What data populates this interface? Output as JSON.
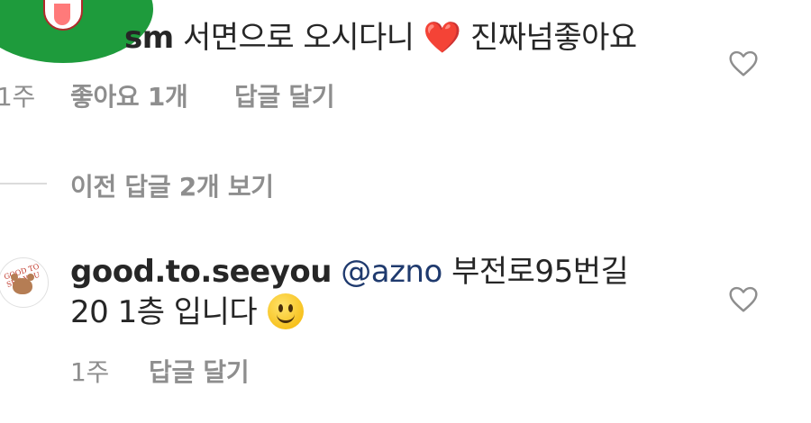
{
  "comment1": {
    "username_partial": "sm",
    "text": "서면으로 오시다니",
    "emoji": "❤️",
    "text_after": "진짜넘좋아요",
    "time": "1주",
    "likes": "좋아요 1개",
    "reply": "답글 달기"
  },
  "view_replies": "이전 답글 2개 보기",
  "comment2": {
    "username": "good.to.seeyou",
    "mention": "@azno",
    "text_line1": "부전로95번길",
    "text_line2": "20 1층 입니다",
    "avatar_text": "GOOD TO SEE YOU",
    "time": "1주",
    "reply": "답글 달기"
  },
  "colors": {
    "text": "#262626",
    "meta": "#8e8e8e",
    "mention": "#1f3a6e",
    "avatar1": "#1e9b3c"
  },
  "icons": [
    "heart-outline-icon",
    "smiley-emoji-icon",
    "red-heart-emoji-icon"
  ]
}
